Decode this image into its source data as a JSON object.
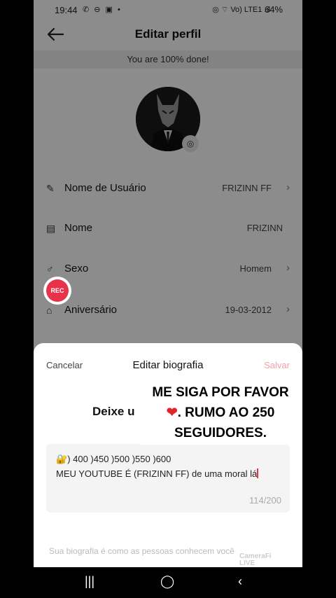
{
  "status_bar": {
    "time": "19:44",
    "left_icons": "✆ ⊖ ▣ •",
    "right_icons": "◎ ⌔ Vo) LTE1 .ıl",
    "battery": "64%"
  },
  "header": {
    "title": "Editar perfil",
    "back_icon": "arrow-left-icon"
  },
  "progress": {
    "text": "You are 100% done!"
  },
  "profile_rows": [
    {
      "label": "Nome de Usuário",
      "value": "FRIZINN FF",
      "icon": "pencil-icon"
    },
    {
      "label": "Nome",
      "value": "FRIZINN",
      "icon": "id-card-icon"
    },
    {
      "label": "Sexo",
      "value": "Homem",
      "icon": "gender-icon"
    },
    {
      "label": "Aniversário",
      "value": "19-03-2012",
      "icon": "cake-icon"
    }
  ],
  "rec_button": {
    "label": "REC"
  },
  "sheet": {
    "cancel": "Cancelar",
    "title": "Editar biografia",
    "save": "Salvar",
    "hint": "Deixe u",
    "bio_line1": ") 400 )450 )500 )550 )600",
    "bio_text": "MEU YOUTUBE É (FRIZINN FF) de uma moral lá",
    "counter": "114/200",
    "footer": "Sua biografia é como as pessoas conhecem você"
  },
  "overlay": {
    "line1": "ME SIGA POR FAVOR",
    "line2": ". RUMO AO 250",
    "line3": "SEGUIDORES."
  },
  "watermark": {
    "line1": "CameraFi",
    "line2": "LIVE"
  },
  "colors": {
    "accent": "#e8324a",
    "save_disabled": "#f2a2a8"
  }
}
